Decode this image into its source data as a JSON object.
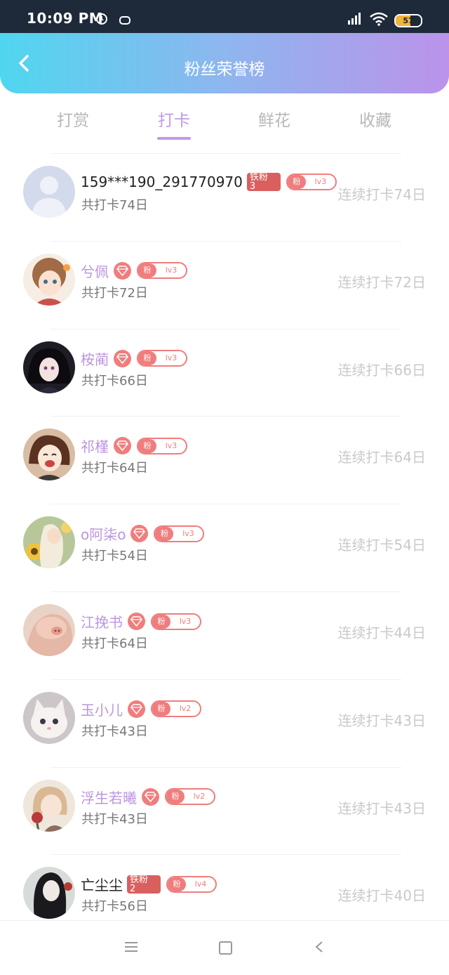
{
  "status_bar": {
    "time": "10:09 PM",
    "battery": "57",
    "battery_level": 0.57
  },
  "header": {
    "title": "粉丝荣誉榜",
    "back_icon": "chevron-left-icon"
  },
  "tabs": [
    {
      "label": "打赏",
      "active": false
    },
    {
      "label": "打卡",
      "active": true
    },
    {
      "label": "鲜花",
      "active": false
    },
    {
      "label": "收藏",
      "active": false
    }
  ],
  "colors": {
    "accent": "#c29ae6",
    "badge": "#f07d7d",
    "tiefen": "#d9605f",
    "header_start": "#4fd6ef",
    "header_end": "#bb93ea"
  },
  "rows": [
    {
      "name": "159***190_291770970",
      "name_style": "dark",
      "badge_type": "tiefen",
      "tiefen_label": "铁粉\n3",
      "fan_label": "粉",
      "level": "lv3",
      "total": "共打卡74日",
      "streak": "连续打卡74日",
      "avatar": "placeholder"
    },
    {
      "name": "兮佩",
      "name_style": "purple",
      "badge_type": "diamond",
      "fan_label": "粉",
      "level": "lv3",
      "total": "共打卡72日",
      "streak": "连续打卡72日",
      "avatar": "girl-brown"
    },
    {
      "name": "桉蔺",
      "name_style": "purple",
      "badge_type": "diamond",
      "fan_label": "粉",
      "level": "lv3",
      "total": "共打卡66日",
      "streak": "连续打卡66日",
      "avatar": "girl-dark"
    },
    {
      "name": "祁槿",
      "name_style": "purple",
      "badge_type": "diamond",
      "fan_label": "粉",
      "level": "lv3",
      "total": "共打卡64日",
      "streak": "连续打卡64日",
      "avatar": "boy-smile"
    },
    {
      "name": "o阿柒o",
      "name_style": "purple",
      "badge_type": "diamond",
      "fan_label": "粉",
      "level": "lv3",
      "total": "共打卡54日",
      "streak": "连续打卡54日",
      "avatar": "sunflower"
    },
    {
      "name": "江挽书",
      "name_style": "purple",
      "badge_type": "diamond",
      "fan_label": "粉",
      "level": "lv3",
      "total": "共打卡64日",
      "streak": "连续打卡44日",
      "avatar": "pig"
    },
    {
      "name": "玉小儿",
      "name_style": "purple",
      "badge_type": "diamond",
      "fan_label": "粉",
      "level": "lv2",
      "total": "共打卡43日",
      "streak": "连续打卡43日",
      "avatar": "kitten"
    },
    {
      "name": "浮生若曦",
      "name_style": "purple",
      "badge_type": "diamond",
      "fan_label": "粉",
      "level": "lv2",
      "total": "共打卡43日",
      "streak": "连续打卡43日",
      "avatar": "rose-girl"
    },
    {
      "name": "亡尘尘",
      "name_style": "dark",
      "badge_type": "tiefen",
      "tiefen_label": "铁粉\n2",
      "fan_label": "粉",
      "level": "lv4",
      "total": "共打卡56日",
      "streak": "连续打卡40日",
      "avatar": "dark-hair"
    }
  ],
  "nav": {
    "menu_icon": "menu-icon",
    "home_icon": "home-square-icon",
    "back_icon": "back-triangle-icon"
  }
}
